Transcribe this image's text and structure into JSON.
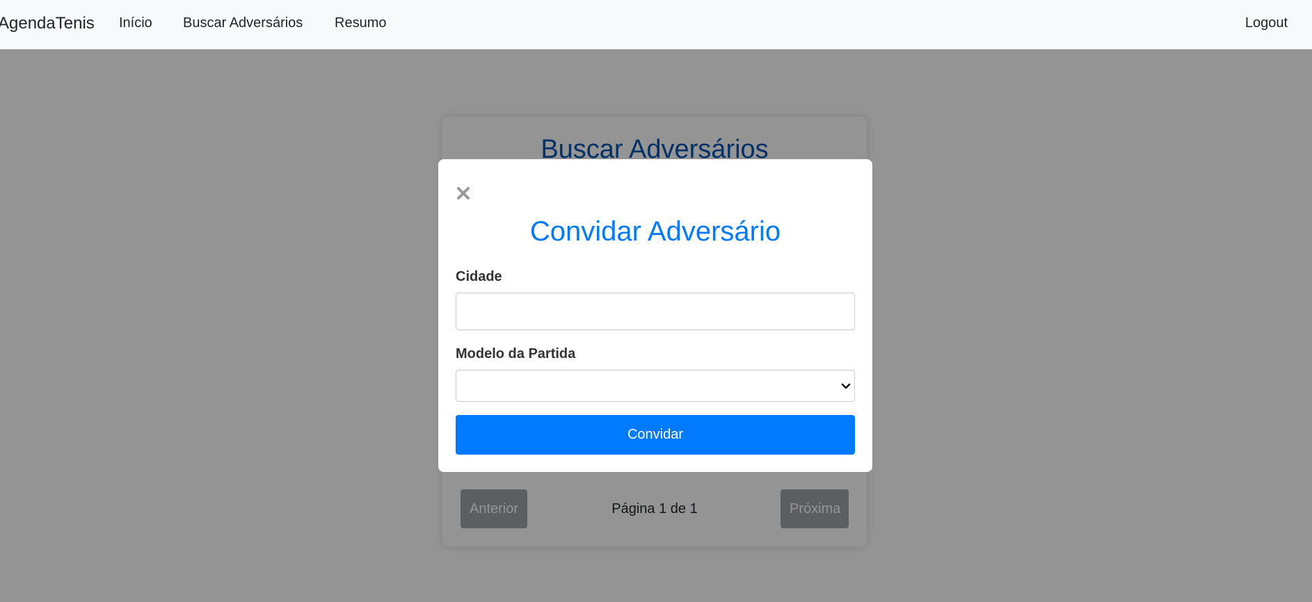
{
  "navbar": {
    "brand": "AgendaTenis",
    "links": [
      "Início",
      "Buscar Adversários",
      "Resumo"
    ],
    "logout": "Logout"
  },
  "page": {
    "title": "Buscar Adversários",
    "pagination": {
      "prev_label": "Anterior",
      "next_label": "Próxima",
      "info": "Página 1 de 1"
    }
  },
  "modal": {
    "title": "Convidar Adversário",
    "close_icon": "close-icon",
    "fields": {
      "cidade": {
        "label": "Cidade",
        "value": "",
        "placeholder": ""
      },
      "modelo": {
        "label": "Modelo da Partida",
        "selected": ""
      }
    },
    "submit_label": "Convidar"
  },
  "colors": {
    "navbar_bg": "#f8f9fa",
    "overlay": "rgba(0,0,0,0.42)",
    "primary": "#007bff",
    "page_title": "#0056b3",
    "disabled_button": "#6c757d"
  }
}
